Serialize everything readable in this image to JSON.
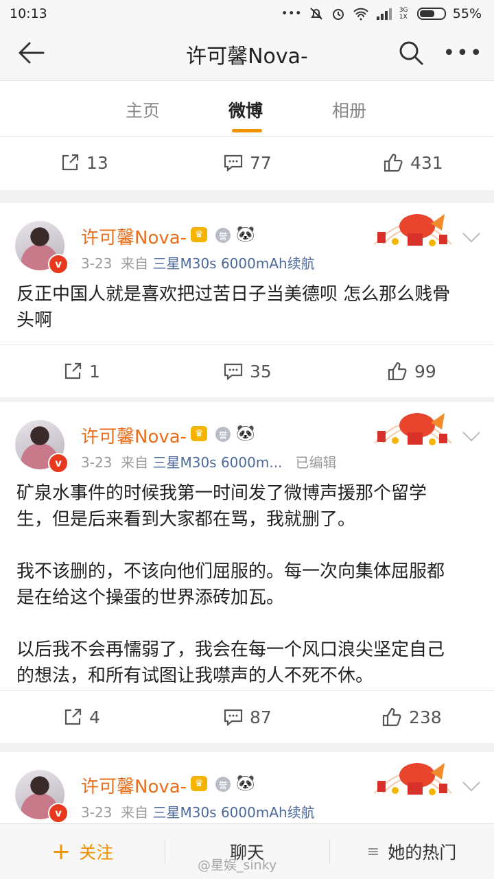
{
  "status_bar": {
    "time": "10:13",
    "signal_label": "3G 1X",
    "battery": "55%"
  },
  "nav": {
    "title": "许可馨Nova-"
  },
  "tabs": [
    {
      "label": "主页",
      "active": false
    },
    {
      "label": "微博",
      "active": true
    },
    {
      "label": "相册",
      "active": false
    }
  ],
  "top_actions": {
    "repost": "13",
    "comment": "77",
    "like": "431"
  },
  "posts": [
    {
      "user": "许可馨Nova-",
      "date": "3-23",
      "from": "来自",
      "source": "三星M30s 6000mAh续航",
      "edited": "",
      "text": "反正中国人就是喜欢把过苦日子当美德呗 怎么那么贱骨\n头啊",
      "repost": "1",
      "comment": "35",
      "like": "99"
    },
    {
      "user": "许可馨Nova-",
      "date": "3-23",
      "from": "来自",
      "source": "三星M30s 6000m...",
      "edited": "已编辑",
      "text": "矿泉水事件的时候我第一时间发了微博声援那个留学\n生，但是后来看到大家都在骂，我就删了。\n\n我不该删的，不该向他们屈服的。每一次向集体屈服都\n是在给这个操蛋的世界添砖加瓦。\n\n以后我不会再懦弱了，我会在每一个风口浪尖坚定自己\n的想法，和所有试图让我噤声的人不死不休。",
      "repost": "4",
      "comment": "87",
      "like": "238"
    },
    {
      "user": "许可馨Nova-",
      "date": "3-23",
      "from": "来自",
      "source": "三星M30s 6000mAh续航",
      "edited": ""
    }
  ],
  "bottom_bar": {
    "follow": "关注",
    "chat": "聊天",
    "hot": "她的热门"
  },
  "watermark": "@星娱_sinky",
  "colors": {
    "accent": "#f29100",
    "username": "#e86e1c",
    "source_link": "#4d6a9c"
  }
}
